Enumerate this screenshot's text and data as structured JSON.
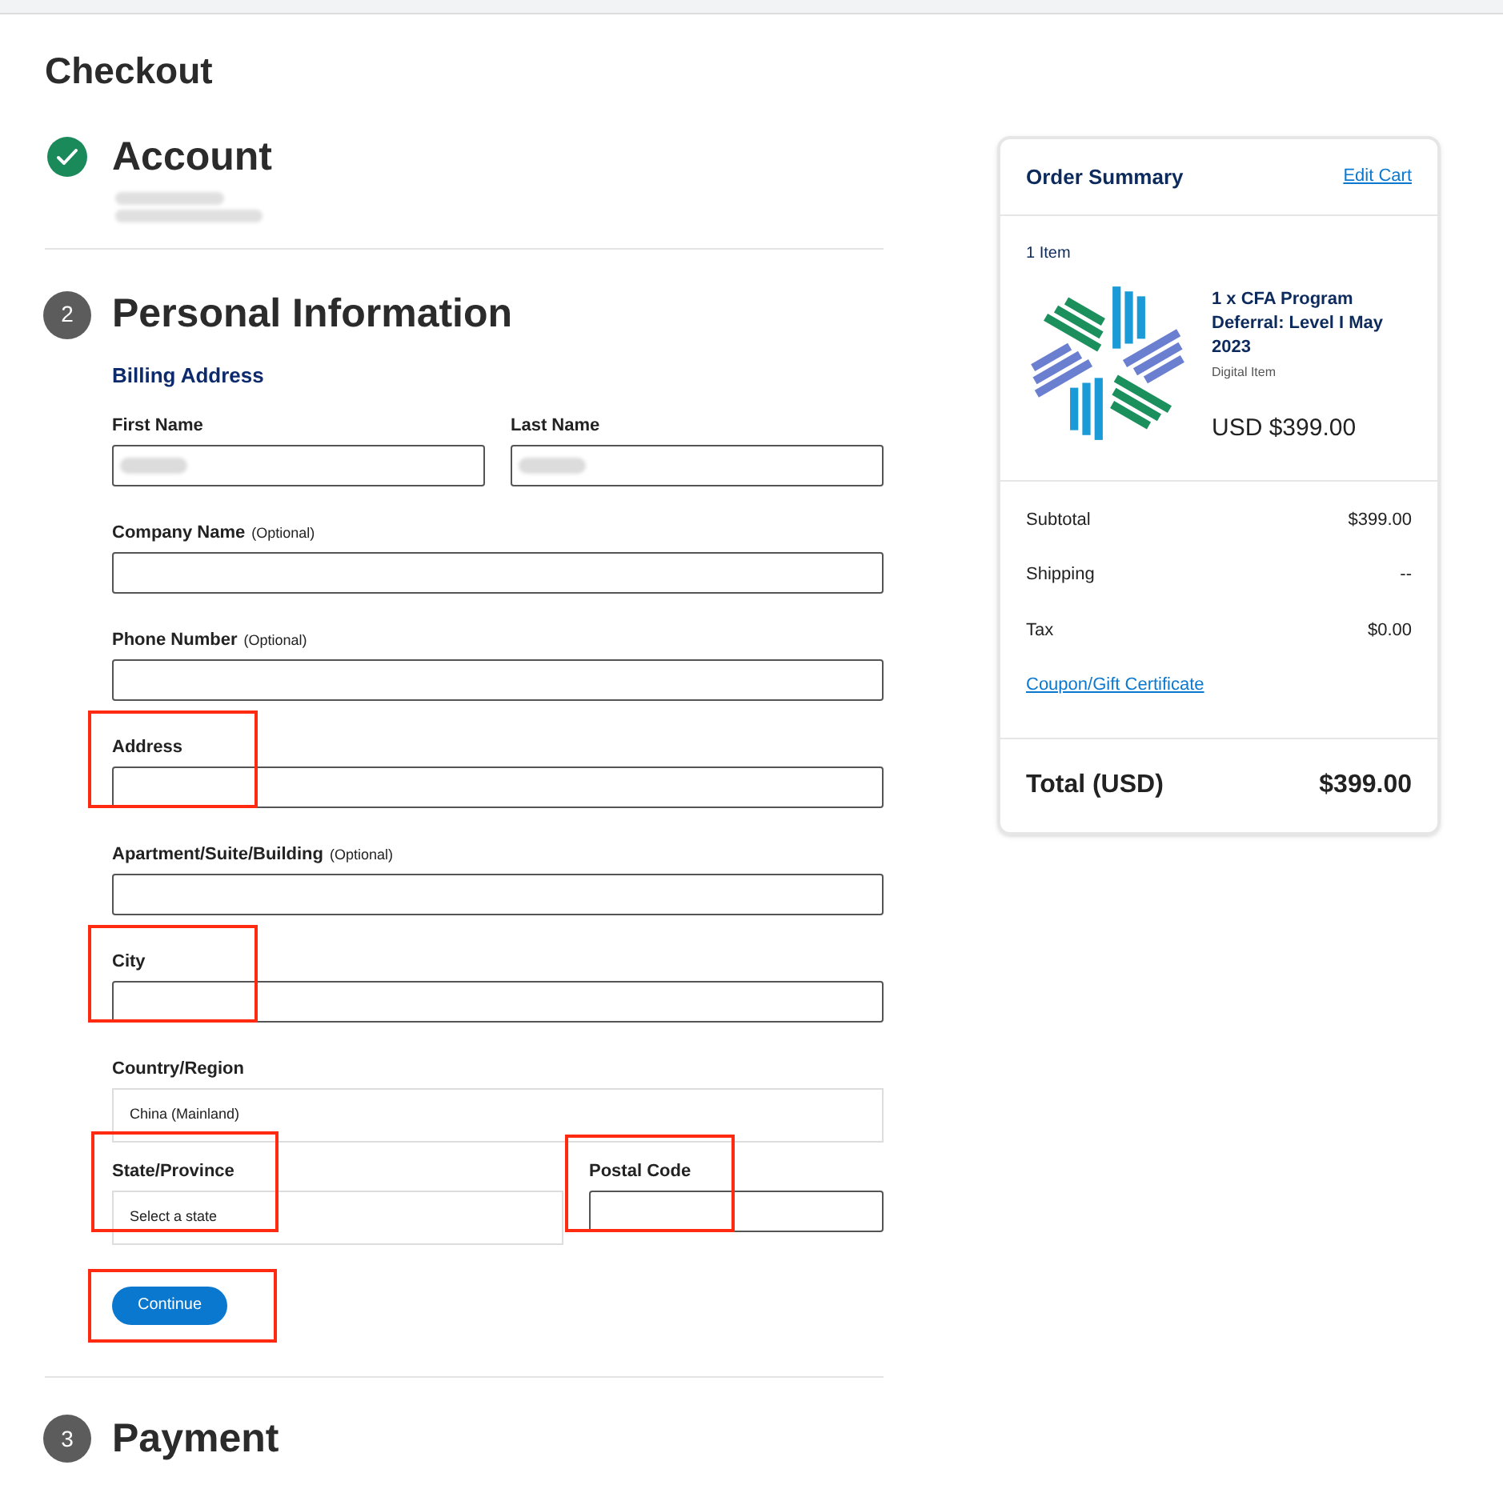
{
  "page_title": "Checkout",
  "steps": [
    {
      "title": "Account",
      "completed": true
    },
    {
      "number": "2",
      "title": "Personal Information",
      "completed": false
    },
    {
      "number": "3",
      "title": "Payment",
      "completed": false
    }
  ],
  "billing": {
    "heading": "Billing Address",
    "rows": [
      [
        {
          "kind": "text",
          "label": "First Name",
          "redacted": true,
          "highlighted": false
        },
        {
          "kind": "text",
          "label": "Last Name",
          "redacted": true,
          "highlighted": false
        }
      ],
      [
        {
          "kind": "text",
          "label": "Company Name",
          "hint": "(Optional)",
          "redacted": false,
          "highlighted": false
        }
      ],
      [
        {
          "kind": "text",
          "label": "Phone Number",
          "hint": "(Optional)",
          "redacted": false,
          "highlighted": false
        }
      ],
      [
        {
          "kind": "text",
          "label": "Address",
          "redacted": false,
          "highlighted": true
        }
      ],
      [
        {
          "kind": "text",
          "label": "Apartment/Suite/Building",
          "hint": "(Optional)",
          "redacted": false,
          "highlighted": false
        }
      ],
      [
        {
          "kind": "text",
          "label": "City",
          "redacted": false,
          "highlighted": true
        }
      ],
      [
        {
          "kind": "select",
          "label": "Country/Region",
          "value": "China (Mainland)",
          "highlighted": false
        }
      ],
      [
        {
          "kind": "select",
          "label": "State/Province",
          "value": "Select a state",
          "highlighted": true
        },
        {
          "kind": "text",
          "label": "Postal Code",
          "redacted": false,
          "highlighted": true
        }
      ]
    ],
    "continue_button": {
      "label": "Continue",
      "highlighted": true
    }
  },
  "order_summary": {
    "title": "Order Summary",
    "edit_link": "Edit Cart",
    "item_count": "1 Item",
    "item": {
      "name": "1 x CFA Program Deferral: Level I May 2023",
      "type": "Digital Item",
      "price": "USD $399.00"
    },
    "lines": [
      {
        "label": "Subtotal",
        "value": "$399.00"
      },
      {
        "label": "Shipping",
        "value": "--"
      },
      {
        "label": "Tax",
        "value": "$0.00"
      }
    ],
    "coupon_link": "Coupon/Gift Certificate",
    "total_label": "Total (USD)",
    "total_value": "$399.00"
  }
}
